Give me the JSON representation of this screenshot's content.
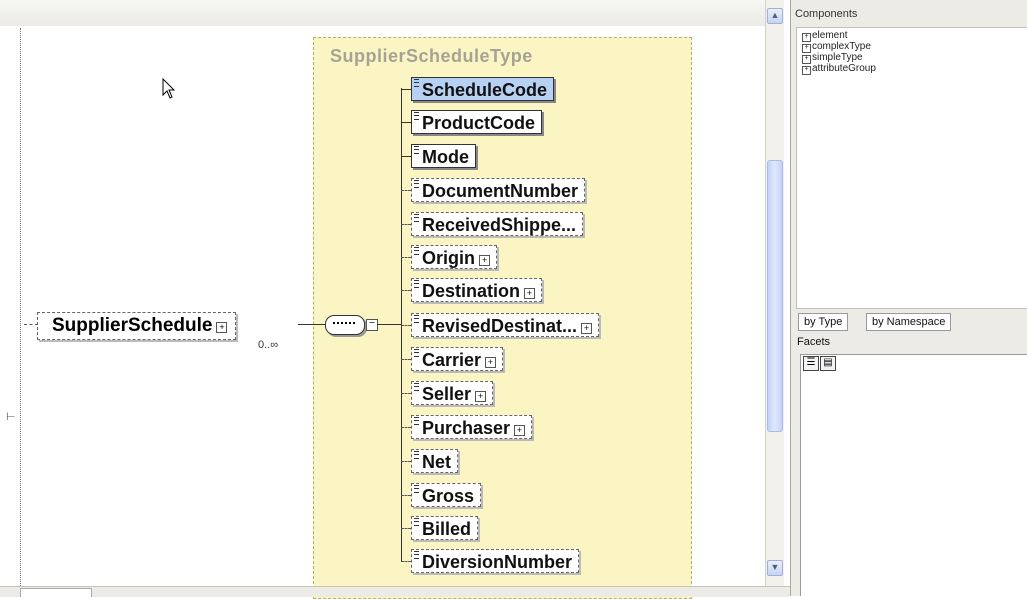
{
  "diagram": {
    "type_title": "SupplierScheduleType",
    "root": {
      "label": "SupplierSchedule",
      "occurrence": "0..∞"
    },
    "elements": [
      {
        "label": "ScheduleCode",
        "kind": "required",
        "selected": true,
        "expandable": false
      },
      {
        "label": "ProductCode",
        "kind": "required",
        "selected": false,
        "expandable": false
      },
      {
        "label": "Mode",
        "kind": "required",
        "selected": false,
        "expandable": false
      },
      {
        "label": "DocumentNumber",
        "kind": "optional",
        "selected": false,
        "expandable": false
      },
      {
        "label": "ReceivedShippe...",
        "kind": "optional",
        "selected": false,
        "expandable": false
      },
      {
        "label": "Origin",
        "kind": "optional",
        "selected": false,
        "expandable": true
      },
      {
        "label": "Destination",
        "kind": "optional",
        "selected": false,
        "expandable": true
      },
      {
        "label": "RevisedDestinat...",
        "kind": "optional",
        "selected": false,
        "expandable": true
      },
      {
        "label": "Carrier",
        "kind": "optional",
        "selected": false,
        "expandable": true
      },
      {
        "label": "Seller",
        "kind": "optional",
        "selected": false,
        "expandable": true
      },
      {
        "label": "Purchaser",
        "kind": "optional",
        "selected": false,
        "expandable": true
      },
      {
        "label": "Net",
        "kind": "optional",
        "selected": false,
        "expandable": false
      },
      {
        "label": "Gross",
        "kind": "optional",
        "selected": false,
        "expandable": false
      },
      {
        "label": "Billed",
        "kind": "optional",
        "selected": false,
        "expandable": false
      },
      {
        "label": "DiversionNumber",
        "kind": "optional",
        "selected": false,
        "expandable": false
      }
    ]
  },
  "components": {
    "title": "Components",
    "items": [
      "element",
      "complexType",
      "simpleType",
      "attributeGroup"
    ]
  },
  "tabs": [
    "by Type",
    "by Namespace"
  ],
  "facets": {
    "title": "Facets"
  },
  "icons": {
    "expand": "⊞",
    "collapse": "⊟",
    "scroll_up": "▲",
    "scroll_down": "▼",
    "cursor": "pointer-arrow"
  },
  "colors": {
    "type_box_bg": "#fbf5c4",
    "selected_bg": "#b6d1f4"
  }
}
